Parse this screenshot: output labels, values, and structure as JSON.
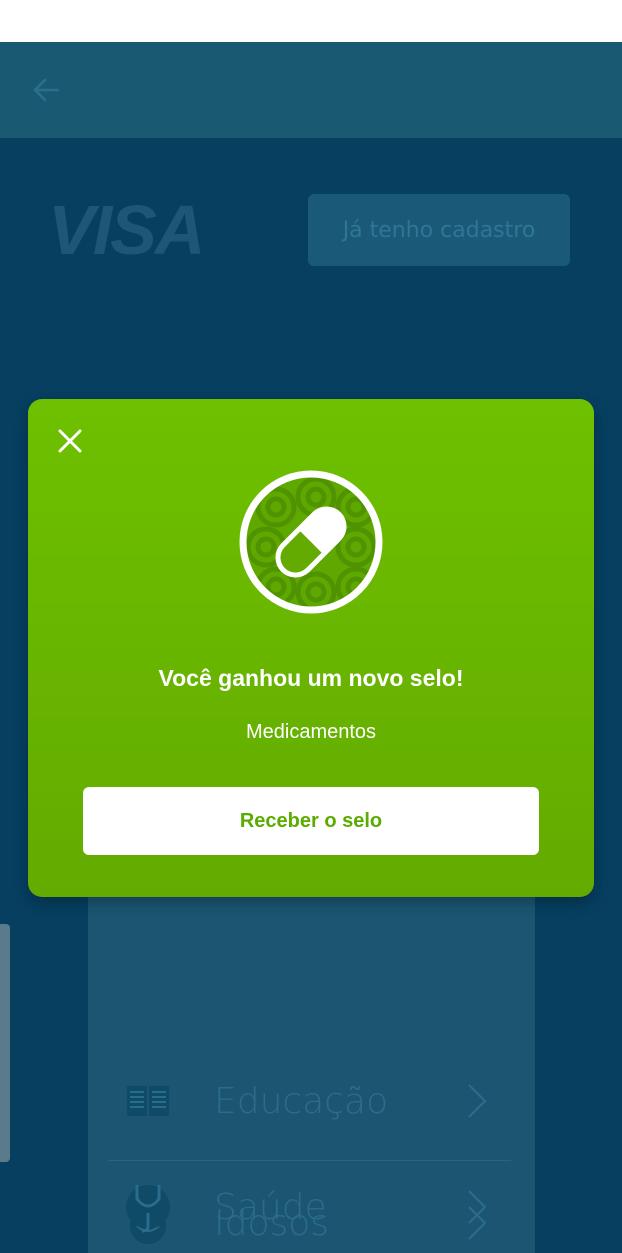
{
  "header": {
    "back_icon": "arrow-left-icon"
  },
  "brand": {
    "logo_text": "VISA"
  },
  "login": {
    "label": "Já tenho cadastro"
  },
  "causes": [
    {
      "label": "Educação",
      "icon": "book-icon"
    },
    {
      "label": "Idosos",
      "icon": "elderly-icon"
    },
    {
      "label": "Saúde",
      "icon": "stethoscope-icon"
    }
  ],
  "modal": {
    "close_icon": "close-icon",
    "badge_icon": "pill-badge-icon",
    "title": "Você ganhou um novo selo!",
    "subtitle": "Medicamentos",
    "button_label": "Receber o selo"
  },
  "colors": {
    "modal_green": "#6ec000",
    "background_blue": "#063f60",
    "button_text_green": "#5aad00"
  }
}
